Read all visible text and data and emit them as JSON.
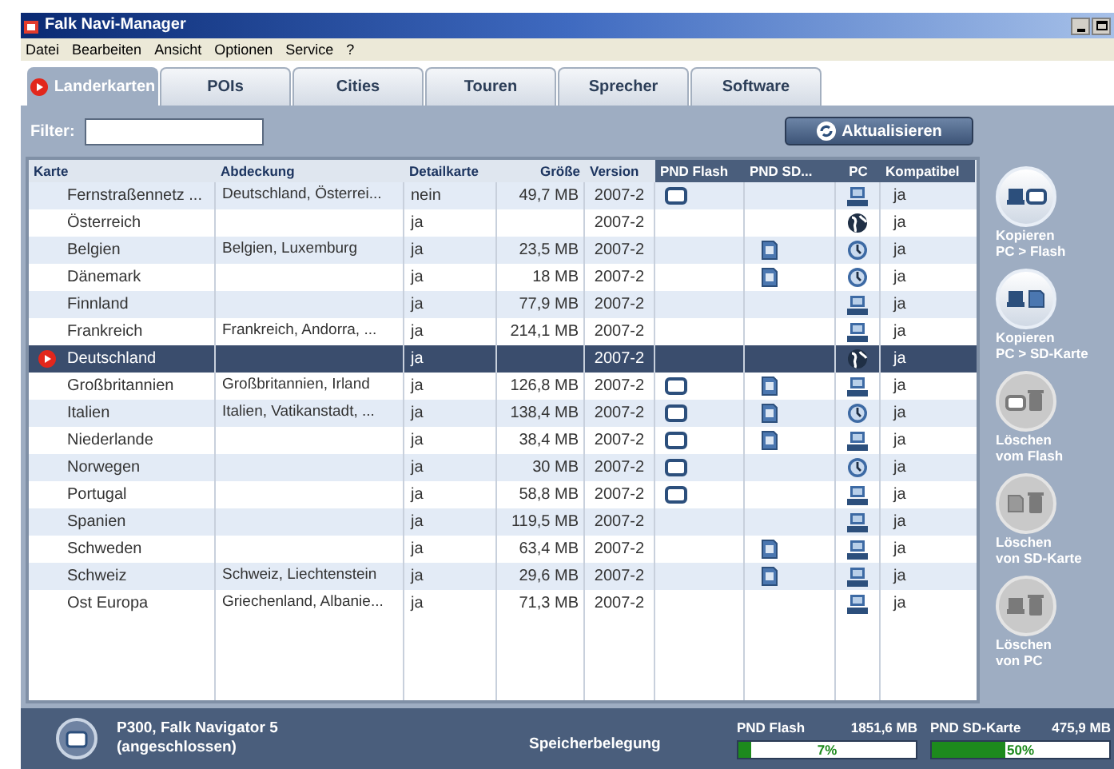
{
  "window": {
    "title": "Falk Navi-Manager"
  },
  "menu": [
    "Datei",
    "Bearbeiten",
    "Ansicht",
    "Optionen",
    "Service",
    "?"
  ],
  "tabs": [
    {
      "label": "Landerkarten",
      "selected": true
    },
    {
      "label": "POIs",
      "selected": false
    },
    {
      "label": "Cities",
      "selected": false
    },
    {
      "label": "Touren",
      "selected": false
    },
    {
      "label": "Sprecher",
      "selected": false
    },
    {
      "label": "Software",
      "selected": false
    }
  ],
  "filter": {
    "label": "Filter:"
  },
  "refresh_button": "Aktualisieren",
  "table": {
    "columns": [
      "Karte",
      "Abdeckung",
      "Detailkarte",
      "Größe",
      "Version",
      "PND Flash",
      "PND SD...",
      "PC",
      "Kompatibel"
    ],
    "rows": [
      {
        "karte": "Fernstraßennetz ...",
        "abdeckung": "Deutschland, Österrei...",
        "detail": "nein",
        "size": "49,7 MB",
        "version": "2007-2",
        "flash": true,
        "sd": false,
        "kind": "computer",
        "compat": "ja",
        "selected": false
      },
      {
        "karte": "Österreich",
        "abdeckung": "",
        "detail": "ja",
        "size": "",
        "version": "2007-2",
        "flash": false,
        "sd": false,
        "kind": "globe",
        "compat": "ja",
        "selected": false
      },
      {
        "karte": "Belgien",
        "abdeckung": "Belgien, Luxemburg",
        "detail": "ja",
        "size": "23,5 MB",
        "version": "2007-2",
        "flash": false,
        "sd": true,
        "kind": "clock",
        "compat": "ja",
        "selected": false
      },
      {
        "karte": "Dänemark",
        "abdeckung": "",
        "detail": "ja",
        "size": "18 MB",
        "version": "2007-2",
        "flash": false,
        "sd": true,
        "kind": "clock",
        "compat": "ja",
        "selected": false
      },
      {
        "karte": "Finnland",
        "abdeckung": "",
        "detail": "ja",
        "size": "77,9 MB",
        "version": "2007-2",
        "flash": false,
        "sd": false,
        "kind": "computer",
        "compat": "ja",
        "selected": false
      },
      {
        "karte": "Frankreich",
        "abdeckung": "Frankreich, Andorra, ...",
        "detail": "ja",
        "size": "214,1 MB",
        "version": "2007-2",
        "flash": false,
        "sd": false,
        "kind": "computer",
        "compat": "ja",
        "selected": false
      },
      {
        "karte": "Deutschland",
        "abdeckung": "",
        "detail": "ja",
        "size": "",
        "version": "2007-2",
        "flash": false,
        "sd": false,
        "kind": "globe",
        "compat": "ja",
        "selected": true
      },
      {
        "karte": "Großbritannien",
        "abdeckung": "Großbritannien, Irland",
        "detail": "ja",
        "size": "126,8 MB",
        "version": "2007-2",
        "flash": true,
        "sd": true,
        "kind": "computer",
        "compat": "ja",
        "selected": false
      },
      {
        "karte": "Italien",
        "abdeckung": "Italien, Vatikanstadt, ...",
        "detail": "ja",
        "size": "138,4 MB",
        "version": "2007-2",
        "flash": true,
        "sd": true,
        "kind": "clock",
        "compat": "ja",
        "selected": false
      },
      {
        "karte": "Niederlande",
        "abdeckung": "",
        "detail": "ja",
        "size": "38,4 MB",
        "version": "2007-2",
        "flash": true,
        "sd": true,
        "kind": "computer",
        "compat": "ja",
        "selected": false
      },
      {
        "karte": "Norwegen",
        "abdeckung": "",
        "detail": "ja",
        "size": "30 MB",
        "version": "2007-2",
        "flash": true,
        "sd": false,
        "kind": "clock",
        "compat": "ja",
        "selected": false
      },
      {
        "karte": "Portugal",
        "abdeckung": "",
        "detail": "ja",
        "size": "58,8 MB",
        "version": "2007-2",
        "flash": true,
        "sd": false,
        "kind": "computer",
        "compat": "ja",
        "selected": false
      },
      {
        "karte": "Spanien",
        "abdeckung": "",
        "detail": "ja",
        "size": "119,5 MB",
        "version": "2007-2",
        "flash": false,
        "sd": false,
        "kind": "computer",
        "compat": "ja",
        "selected": false
      },
      {
        "karte": "Schweden",
        "abdeckung": "",
        "detail": "ja",
        "size": "63,4 MB",
        "version": "2007-2",
        "flash": false,
        "sd": true,
        "kind": "computer",
        "compat": "ja",
        "selected": false
      },
      {
        "karte": "Schweiz",
        "abdeckung": "Schweiz, Liechtenstein",
        "detail": "ja",
        "size": "29,6 MB",
        "version": "2007-2",
        "flash": false,
        "sd": true,
        "kind": "computer",
        "compat": "ja",
        "selected": false
      },
      {
        "karte": "Ost Europa",
        "abdeckung": "Griechenland, Albanie...",
        "detail": "ja",
        "size": "71,3 MB",
        "version": "2007-2",
        "flash": false,
        "sd": false,
        "kind": "computer",
        "compat": "ja",
        "selected": false
      }
    ]
  },
  "actions": [
    {
      "kind": "copy-flash",
      "lines": [
        "Kopieren",
        "PC > Flash"
      ],
      "disabled": false
    },
    {
      "kind": "copy-sd",
      "lines": [
        "Kopieren",
        "PC > SD-Karte"
      ],
      "disabled": false
    },
    {
      "kind": "delete-flash",
      "lines": [
        "Löschen",
        "vom Flash"
      ],
      "disabled": true
    },
    {
      "kind": "delete-sd",
      "lines": [
        "Löschen",
        "von SD-Karte"
      ],
      "disabled": true
    },
    {
      "kind": "delete-pc",
      "lines": [
        "Löschen",
        "von PC"
      ],
      "disabled": true
    }
  ],
  "status_bar": {
    "device": "P300, Falk Navigator 5",
    "device_state": "(angeschlossen)",
    "memory_label": "Speicherbelegung",
    "meters": [
      {
        "name": "PND Flash",
        "size": "1851,6 MB",
        "level": 0.07,
        "reading": "7%"
      },
      {
        "name": "PND SD-Karte",
        "size": "475,9 MB",
        "level": 0.5,
        "reading": "50%"
      }
    ]
  }
}
